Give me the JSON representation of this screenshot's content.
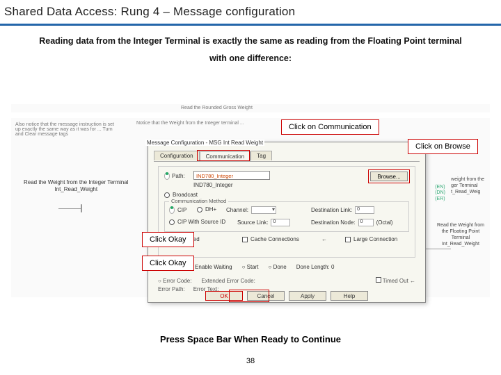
{
  "title": "Shared Data Access: Rung 4 – Message configuration",
  "intro_line1": "Reading data from the Integer Terminal is exactly the same as reading from the Floating Point terminal",
  "intro_line2": "with one difference:",
  "callouts": {
    "communication": "Click on Communication",
    "browse": "Click on Browse",
    "okay1": "Click Okay",
    "okay2": "Click Okay"
  },
  "ghost": {
    "header": "Read the Rounded Gross Weight",
    "note": "Notice that the Weight from the Integer terminal ...",
    "note2": "Also notice that the message instruction is set up exactly the same way as it was for ... Turn and Clear message tags",
    "left_label": "Read the Weight from the Integer Terminal",
    "left_tag": "Int_Read_Weight",
    "right_label1": "weight from the",
    "right_label2": "ger Terminal",
    "right_tag": "t_Read_Weig",
    "right_en": "(EN)",
    "right_dn": "(DN)",
    "right_er": "(ER)",
    "right_block_l1": "Read the Weight from",
    "right_block_l2": "the Floating Point",
    "right_block_l3": "Terminal",
    "right_block_l4": "Int_Read_Weight"
  },
  "dialog": {
    "title": "Message Configuration - MSG Int Read Weight",
    "tabs": {
      "config": "Configuration",
      "comm": "Communication",
      "tag": "Tag"
    },
    "path_radio": "Path:",
    "path_value": "IND780_Integer",
    "path_caption": "IND780_Integer",
    "browse": "Browse...",
    "broadcast": "Broadcast",
    "comm_method": "Communication Method",
    "cip_radio": "CIP",
    "dh_radio": "DH+",
    "channel_lbl": "Channel:",
    "channel_val": "",
    "dest_link_lbl": "Destination Link:",
    "dest_link_val": "0",
    "cip_src": "CIP With Source ID",
    "src_link_lbl": "Source Link:",
    "src_link_val": "0",
    "dest_node_lbl": "Destination Node:",
    "dest_node_val": "0",
    "octal": "(Octal)",
    "connected": "Connected",
    "cache": "Cache Connections",
    "large": "Large Connection",
    "enable": "Enable",
    "enable_wait": "Enable Waiting",
    "start": "Start",
    "done": "Done",
    "done_len_lbl": "Done Length:",
    "done_len_val": "0",
    "err_code": "Error Code:",
    "ext_err": "Extended Error Code:",
    "timed_out": "Timed Out",
    "err_path": "Error Path:",
    "err_text": "Error Text:",
    "ok": "OK",
    "cancel": "Cancel",
    "apply": "Apply",
    "help": "Help"
  },
  "press": "Press Space Bar When Ready to Continue",
  "page": "38"
}
